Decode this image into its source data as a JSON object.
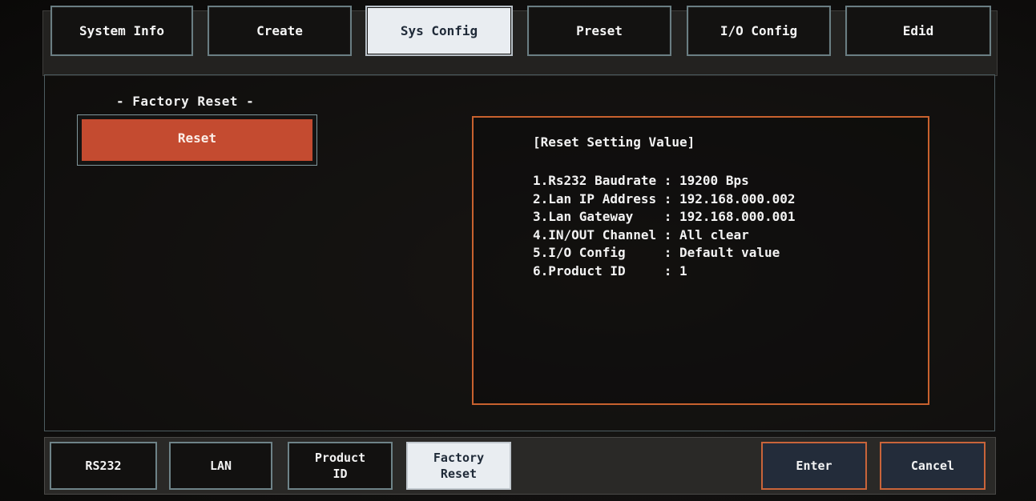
{
  "top_tabs": [
    {
      "label": "System Info"
    },
    {
      "label": "Create"
    },
    {
      "label": "Sys Config",
      "active": true
    },
    {
      "label": "Preset"
    },
    {
      "label": "I/O Config"
    },
    {
      "label": "Edid"
    }
  ],
  "factory_reset": {
    "section_title": "- Factory Reset -",
    "reset_button": "Reset"
  },
  "reset_values": {
    "heading": "[Reset Setting Value]",
    "items": [
      "1.Rs232 Baudrate : 19200 Bps",
      "2.Lan IP Address : 192.168.000.002",
      "3.Lan Gateway    : 192.168.000.001",
      "4.IN/OUT Channel : All clear",
      "5.I/O Config     : Default value",
      "6.Product ID     : 1"
    ]
  },
  "bottom_tabs": [
    {
      "label": "RS232"
    },
    {
      "label": "LAN"
    },
    {
      "label": "Product\nID"
    },
    {
      "label": "Factory\nReset",
      "active": true
    }
  ],
  "actions": {
    "enter": "Enter",
    "cancel": "Cancel"
  },
  "colors": {
    "accent_orange": "#c8612e",
    "reset_red": "#c44b30",
    "active_tab_bg": "#e9edf1",
    "tab_border": "#6a7e83"
  }
}
